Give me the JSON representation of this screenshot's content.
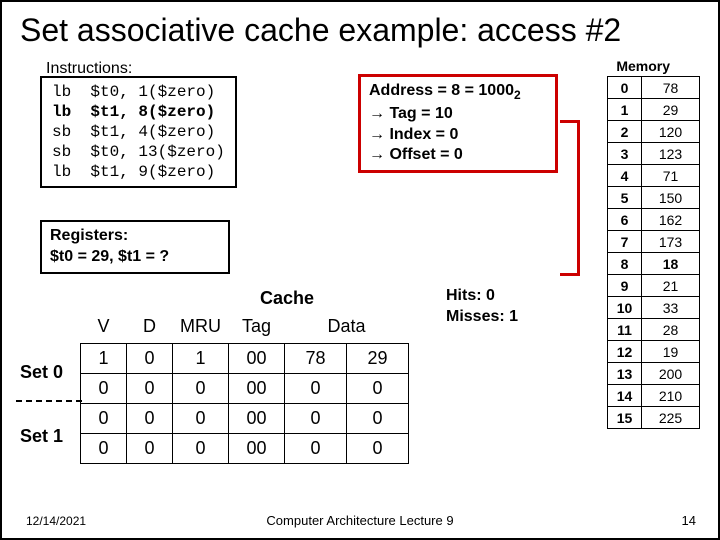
{
  "title": "Set associative cache example: access #2",
  "instr_header": "Instructions:",
  "instructions": [
    {
      "op": "lb",
      "reg": "$t0,",
      "addr": "1($zero)",
      "bold": false
    },
    {
      "op": "lb",
      "reg": "$t1,",
      "addr": "8($zero)",
      "bold": true
    },
    {
      "op": "sb",
      "reg": "$t1,",
      "addr": "4($zero)",
      "bold": false
    },
    {
      "op": "sb",
      "reg": "$t0,",
      "addr": "13($zero)",
      "bold": false
    },
    {
      "op": "lb",
      "reg": "$t1,",
      "addr": "9($zero)",
      "bold": false
    }
  ],
  "addr_box": {
    "line1a": "Address = 8 = 1000",
    "line1b": "2",
    "line2": "→ Tag = 10",
    "line3": "→ Index = 0",
    "line4": "→ Offset = 0"
  },
  "registers": {
    "line1": "Registers:",
    "line2": "$t0 = 29, $t1 = ?"
  },
  "memory_label": "Memory",
  "memory": [
    {
      "idx": "0",
      "val": "78",
      "hl": false
    },
    {
      "idx": "1",
      "val": "29",
      "hl": false
    },
    {
      "idx": "2",
      "val": "120",
      "hl": false
    },
    {
      "idx": "3",
      "val": "123",
      "hl": false
    },
    {
      "idx": "4",
      "val": "71",
      "hl": false
    },
    {
      "idx": "5",
      "val": "150",
      "hl": false
    },
    {
      "idx": "6",
      "val": "162",
      "hl": false
    },
    {
      "idx": "7",
      "val": "173",
      "hl": false
    },
    {
      "idx": "8",
      "val": "18",
      "hl": true
    },
    {
      "idx": "9",
      "val": "21",
      "hl": false
    },
    {
      "idx": "10",
      "val": "33",
      "hl": false
    },
    {
      "idx": "11",
      "val": "28",
      "hl": false
    },
    {
      "idx": "12",
      "val": "19",
      "hl": false
    },
    {
      "idx": "13",
      "val": "200",
      "hl": false
    },
    {
      "idx": "14",
      "val": "210",
      "hl": false
    },
    {
      "idx": "15",
      "val": "225",
      "hl": false
    }
  ],
  "cache_label": "Cache",
  "hits": "Hits:  0",
  "misses": "Misses: 1",
  "cache_headers": {
    "v": "V",
    "d": "D",
    "mru": "MRU",
    "tag": "Tag",
    "data": "Data"
  },
  "set0_label": "Set 0",
  "set1_label": "Set 1",
  "cache_rows": [
    {
      "v": "1",
      "d": "0",
      "mru": "1",
      "tag": "00",
      "d0": "78",
      "d1": "29"
    },
    {
      "v": "0",
      "d": "0",
      "mru": "0",
      "tag": "00",
      "d0": "0",
      "d1": "0"
    },
    {
      "v": "0",
      "d": "0",
      "mru": "0",
      "tag": "00",
      "d0": "0",
      "d1": "0"
    },
    {
      "v": "0",
      "d": "0",
      "mru": "0",
      "tag": "00",
      "d0": "0",
      "d1": "0"
    }
  ],
  "footer": {
    "date": "12/14/2021",
    "mid": "Computer Architecture Lecture 9",
    "num": "14"
  }
}
